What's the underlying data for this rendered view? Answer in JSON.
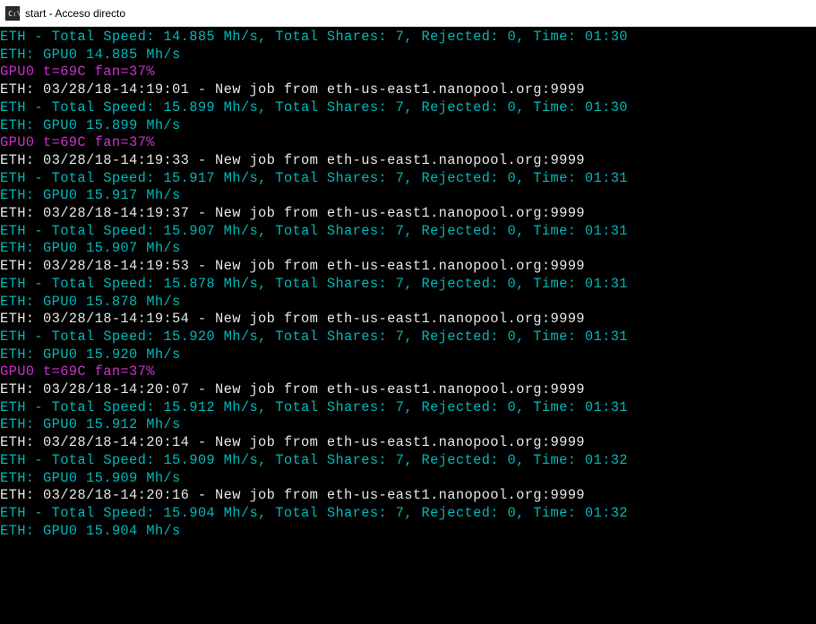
{
  "window": {
    "title": "start - Acceso directo"
  },
  "lines": [
    {
      "c": "teal",
      "t": "ETH - Total Speed: 14.885 Mh/s, Total Shares: 7, Rejected: 0, Time: 01:30"
    },
    {
      "c": "teal",
      "t": "ETH: GPU0 14.885 Mh/s"
    },
    {
      "c": "magenta",
      "t": "GPU0 t=69C fan=37%"
    },
    {
      "c": "white",
      "t": "ETH: 03/28/18-14:19:01 - New job from eth-us-east1.nanopool.org:9999"
    },
    {
      "c": "teal",
      "t": "ETH - Total Speed: 15.899 Mh/s, Total Shares: 7, Rejected: 0, Time: 01:30"
    },
    {
      "c": "teal",
      "t": "ETH: GPU0 15.899 Mh/s"
    },
    {
      "c": "magenta",
      "t": "GPU0 t=69C fan=37%"
    },
    {
      "c": "white",
      "t": "ETH: 03/28/18-14:19:33 - New job from eth-us-east1.nanopool.org:9999"
    },
    {
      "c": "teal",
      "t": "ETH - Total Speed: 15.917 Mh/s, Total Shares: 7, Rejected: 0, Time: 01:31"
    },
    {
      "c": "teal",
      "t": "ETH: GPU0 15.917 Mh/s"
    },
    {
      "c": "white",
      "t": "ETH: 03/28/18-14:19:37 - New job from eth-us-east1.nanopool.org:9999"
    },
    {
      "c": "teal",
      "t": "ETH - Total Speed: 15.907 Mh/s, Total Shares: 7, Rejected: 0, Time: 01:31"
    },
    {
      "c": "teal",
      "t": "ETH: GPU0 15.907 Mh/s"
    },
    {
      "c": "white",
      "t": "ETH: 03/28/18-14:19:53 - New job from eth-us-east1.nanopool.org:9999"
    },
    {
      "c": "teal",
      "t": "ETH - Total Speed: 15.878 Mh/s, Total Shares: 7, Rejected: 0, Time: 01:31"
    },
    {
      "c": "teal",
      "t": "ETH: GPU0 15.878 Mh/s"
    },
    {
      "c": "white",
      "t": "ETH: 03/28/18-14:19:54 - New job from eth-us-east1.nanopool.org:9999"
    },
    {
      "c": "teal",
      "t": "ETH - Total Speed: 15.920 Mh/s, Total Shares: 7, Rejected: 0, Time: 01:31"
    },
    {
      "c": "teal",
      "t": "ETH: GPU0 15.920 Mh/s"
    },
    {
      "c": "magenta",
      "t": "GPU0 t=69C fan=37%"
    },
    {
      "c": "white",
      "t": "ETH: 03/28/18-14:20:07 - New job from eth-us-east1.nanopool.org:9999"
    },
    {
      "c": "teal",
      "t": "ETH - Total Speed: 15.912 Mh/s, Total Shares: 7, Rejected: 0, Time: 01:31"
    },
    {
      "c": "teal",
      "t": "ETH: GPU0 15.912 Mh/s"
    },
    {
      "c": "white",
      "t": "ETH: 03/28/18-14:20:14 - New job from eth-us-east1.nanopool.org:9999"
    },
    {
      "c": "teal",
      "t": "ETH - Total Speed: 15.909 Mh/s, Total Shares: 7, Rejected: 0, Time: 01:32"
    },
    {
      "c": "teal",
      "t": "ETH: GPU0 15.909 Mh/s"
    },
    {
      "c": "white",
      "t": "ETH: 03/28/18-14:20:16 - New job from eth-us-east1.nanopool.org:9999"
    },
    {
      "c": "teal",
      "t": "ETH - Total Speed: 15.904 Mh/s, Total Shares: 7, Rejected: 0, Time: 01:32"
    },
    {
      "c": "teal",
      "t": "ETH: GPU0 15.904 Mh/s"
    }
  ]
}
